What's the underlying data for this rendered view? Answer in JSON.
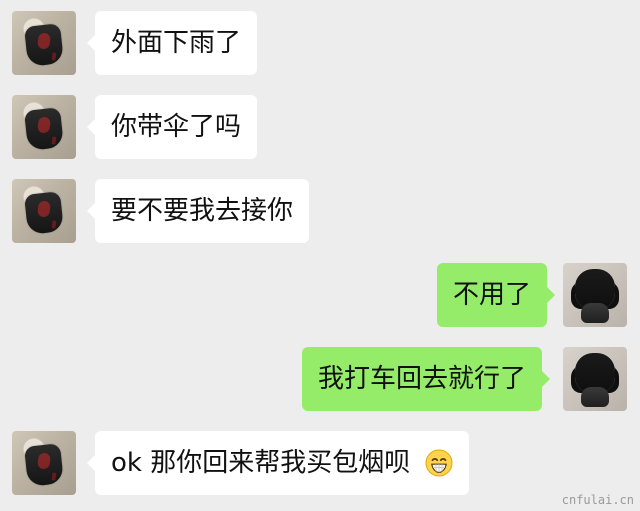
{
  "chat": {
    "messages": [
      {
        "from": "other",
        "text": "外面下雨了"
      },
      {
        "from": "other",
        "text": "你带伞了吗"
      },
      {
        "from": "other",
        "text": "要不要我去接你"
      },
      {
        "from": "me",
        "text": "不用了"
      },
      {
        "from": "me",
        "text": "我打车回去就行了"
      },
      {
        "from": "other",
        "text": "ok 那你回来帮我买包烟呗",
        "emoji": "grinning-emoji-icon"
      }
    ]
  },
  "watermark": "cnfulai.cn",
  "colors": {
    "background": "#ededed",
    "incoming_bubble": "#ffffff",
    "outgoing_bubble": "#95ec69",
    "text": "#111111"
  }
}
